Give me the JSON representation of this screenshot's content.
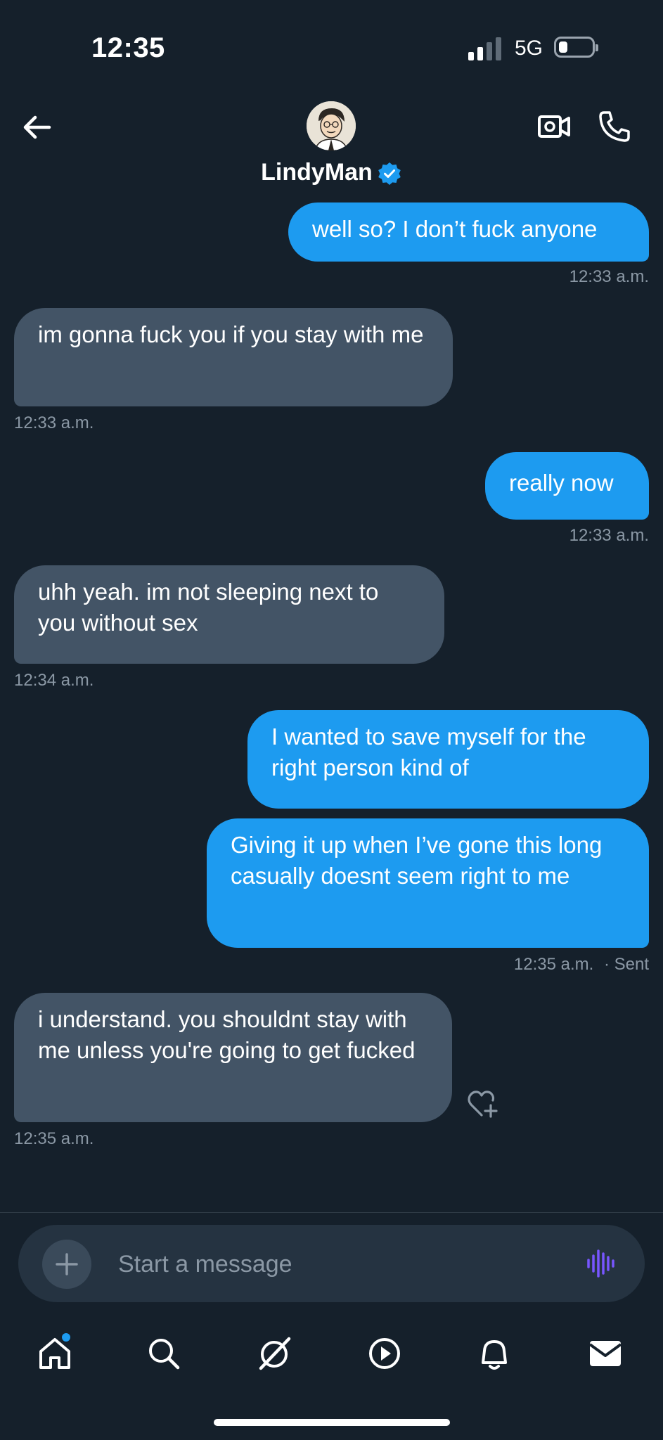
{
  "status_bar": {
    "time": "12:35",
    "network": "5G"
  },
  "header": {
    "contact_name": "LindyMan",
    "verified": true
  },
  "messages": [
    {
      "direction": "sent",
      "text": "well so? I don’t fuck anyone",
      "timestamp": "12:33 a.m."
    },
    {
      "direction": "received",
      "text": "im gonna fuck you if you stay with me",
      "timestamp": "12:33 a.m."
    },
    {
      "direction": "sent",
      "text": "really now",
      "timestamp": "12:33 a.m."
    },
    {
      "direction": "received",
      "text": "uhh yeah. im not sleeping next to you without sex",
      "timestamp": "12:34 a.m."
    },
    {
      "direction": "sent",
      "text": "I wanted to save myself for the right person kind of"
    },
    {
      "direction": "sent",
      "text": "Giving it up when I’ve gone this long casually doesnt seem right to me",
      "timestamp": "12:35 a.m.",
      "status": "· Sent"
    },
    {
      "direction": "received",
      "text": "i understand. you shouldnt stay with me unless you're going to get fucked",
      "timestamp": "12:35 a.m."
    }
  ],
  "composer": {
    "placeholder": "Start a message"
  },
  "nav": {
    "items": [
      {
        "icon": "home-icon",
        "badge": true
      },
      {
        "icon": "search-icon"
      },
      {
        "icon": "grok-icon"
      },
      {
        "icon": "video-play-icon"
      },
      {
        "icon": "bell-icon"
      },
      {
        "icon": "mail-icon",
        "active": true
      }
    ]
  },
  "colors": {
    "background": "#15202b",
    "sent_bubble": "#1d9bf0",
    "received_bubble": "#435466",
    "timestamp": "#8b98a5",
    "voice_accent": "#7856ff"
  }
}
